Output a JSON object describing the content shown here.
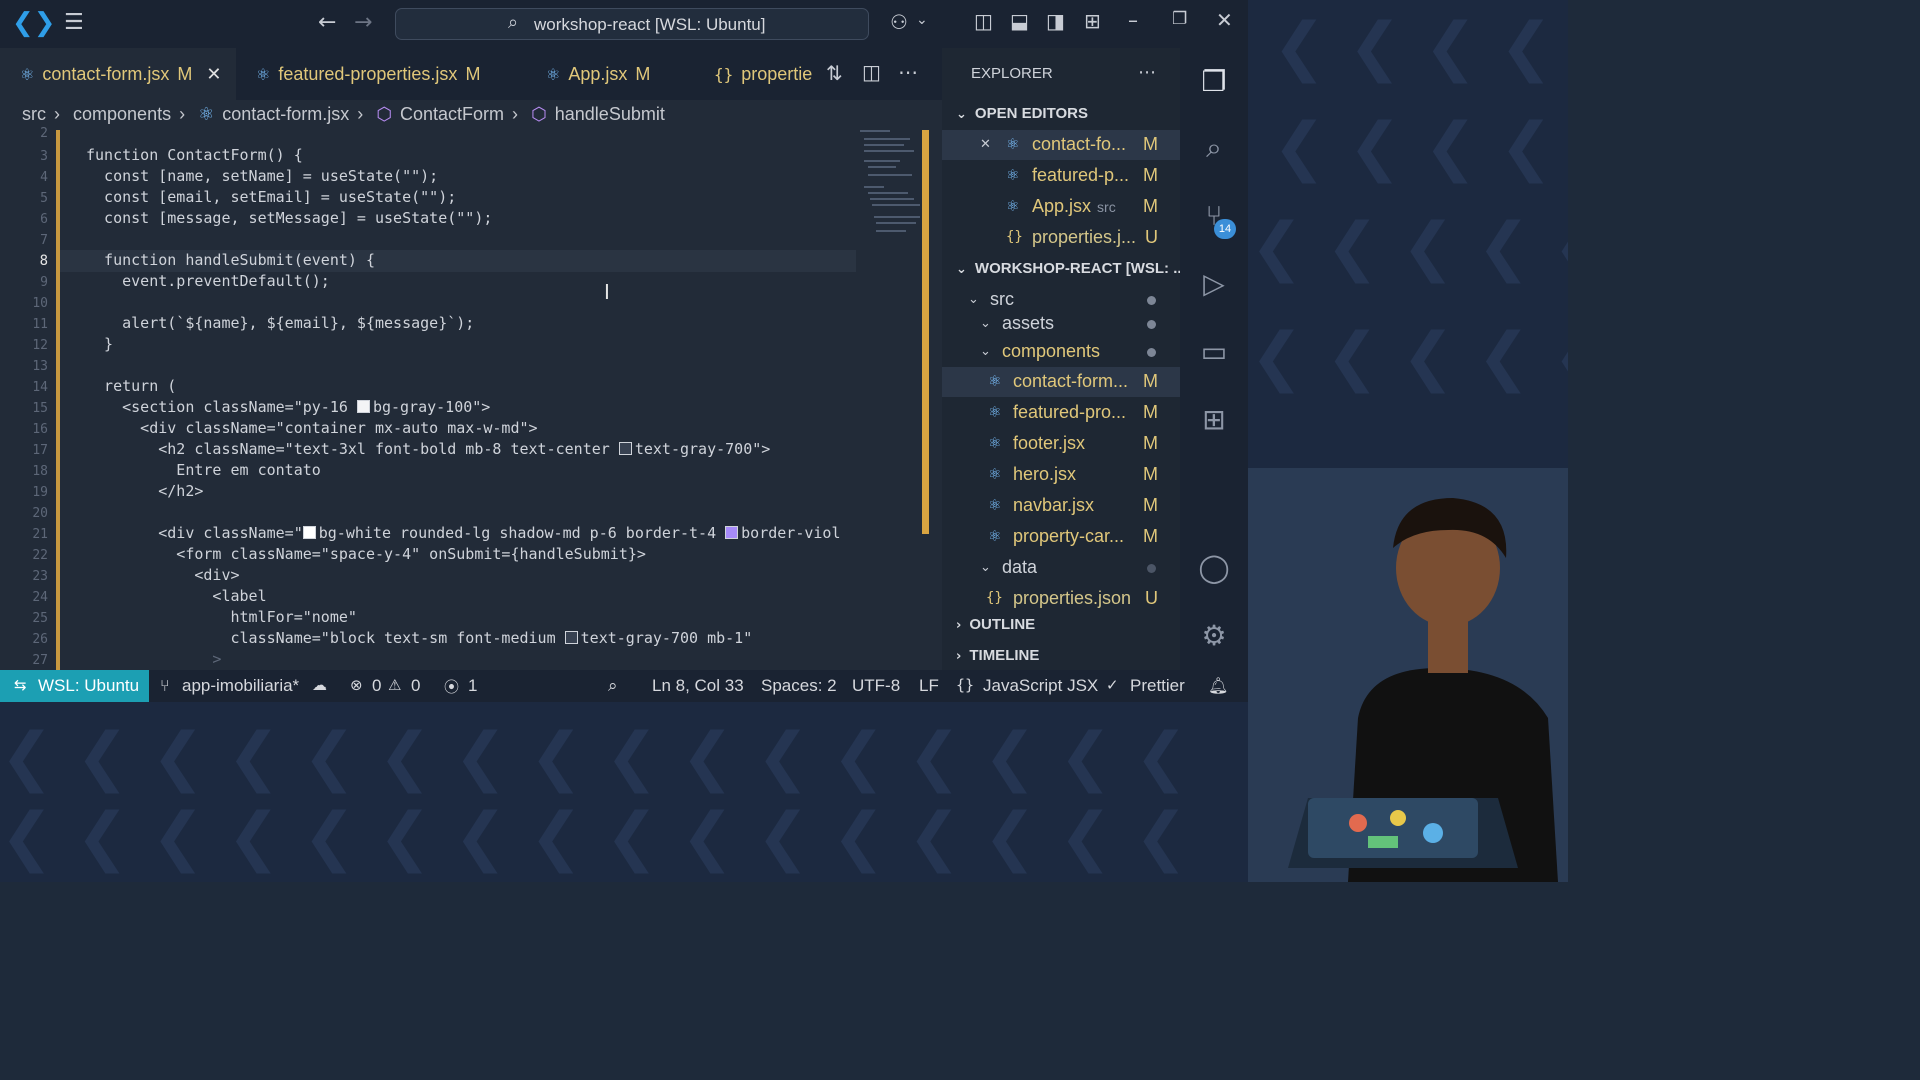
{
  "titlebar": {
    "search_text": "workshop-react [WSL: Ubuntu]"
  },
  "tabs": [
    {
      "label": "contact-form.jsx",
      "status": "M"
    },
    {
      "label": "featured-properties.jsx",
      "status": "M"
    },
    {
      "label": "App.jsx",
      "status": "M"
    },
    {
      "label": "propertie"
    }
  ],
  "breadcrumb": [
    "src",
    "components",
    "contact-form.jsx",
    "ContactForm",
    "handleSubmit"
  ],
  "line_numbers": [
    "2",
    "3",
    "4",
    "5",
    "6",
    "7",
    "8",
    "9",
    "10",
    "11",
    "12",
    "13",
    "14",
    "15",
    "16",
    "17",
    "18",
    "19",
    "20",
    "21",
    "22",
    "23",
    "24",
    "25",
    "26",
    "27"
  ],
  "current_line": "8",
  "code": {
    "l3": "function ContactForm() {",
    "l4": "  const [name, setName] = useState(\"\");",
    "l5": "  const [email, setEmail] = useState(\"\");",
    "l6": "  const [message, setMessage] = useState(\"\");",
    "l8": "  function handleSubmit(event) {",
    "l9": "    event.preventDefault();",
    "l11": "    alert(`${name}, ${email}, ${message}`);",
    "l12": "  }",
    "l14": "  return (",
    "l15a": "    <section className=\"py-16 ",
    "l15b": "bg-gray-100\">",
    "l16": "      <div className=\"container mx-auto max-w-md\">",
    "l17a": "        <h2 className=\"text-3xl font-bold mb-8 text-center ",
    "l17b": "text-gray-700\">",
    "l18": "          Entre em contato",
    "l19": "        </h2>",
    "l21a": "        <div className=\"",
    "l21b": "bg-white rounded-lg shadow-md p-6 border-t-4 ",
    "l21c": "border-viol",
    "l22": "          <form className=\"space-y-4\" onSubmit={handleSubmit}>",
    "l23": "            <div>",
    "l24": "              <label",
    "l25": "                htmlFor=\"nome\"",
    "l26a": "                className=\"block text-sm font-medium ",
    "l26b": "text-gray-700 mb-1\"",
    "l27": "              >"
  },
  "explorer": {
    "title": "EXPLORER",
    "open_editors_label": "OPEN EDITORS",
    "open_editors": [
      {
        "name": "contact-fo...",
        "status": "M"
      },
      {
        "name": "featured-p...",
        "status": "M"
      },
      {
        "name": "App.jsx",
        "sub": "src",
        "status": "M"
      },
      {
        "name": "properties.j...",
        "status": "U"
      }
    ],
    "workspace_label": "WORKSHOP-REACT [WSL: ...",
    "tree": [
      {
        "name": "src"
      },
      {
        "name": "assets"
      },
      {
        "name": "components"
      },
      {
        "name": "contact-form...",
        "status": "M"
      },
      {
        "name": "featured-pro...",
        "status": "M"
      },
      {
        "name": "footer.jsx",
        "status": "M"
      },
      {
        "name": "hero.jsx",
        "status": "M"
      },
      {
        "name": "navbar.jsx",
        "status": "M"
      },
      {
        "name": "property-car...",
        "status": "M"
      },
      {
        "name": "data"
      },
      {
        "name": "properties.json",
        "status": "U"
      }
    ],
    "outline_label": "OUTLINE",
    "timeline_label": "TIMELINE"
  },
  "activity": {
    "source_control_badge": "14"
  },
  "status": {
    "remote": "WSL: Ubuntu",
    "branch": "app-imobiliaria*",
    "errors": "0",
    "warnings": "0",
    "ports": "1",
    "position": "Ln 8, Col 33",
    "spaces": "Spaces: 2",
    "encoding": "UTF-8",
    "eol": "LF",
    "language": "JavaScript JSX",
    "formatter": "Prettier"
  },
  "colors": {
    "accent": "#1c9fb3",
    "modified": "#e0c77a",
    "badge": "#3b8fd8",
    "scroll_marker": "#d9a441"
  }
}
